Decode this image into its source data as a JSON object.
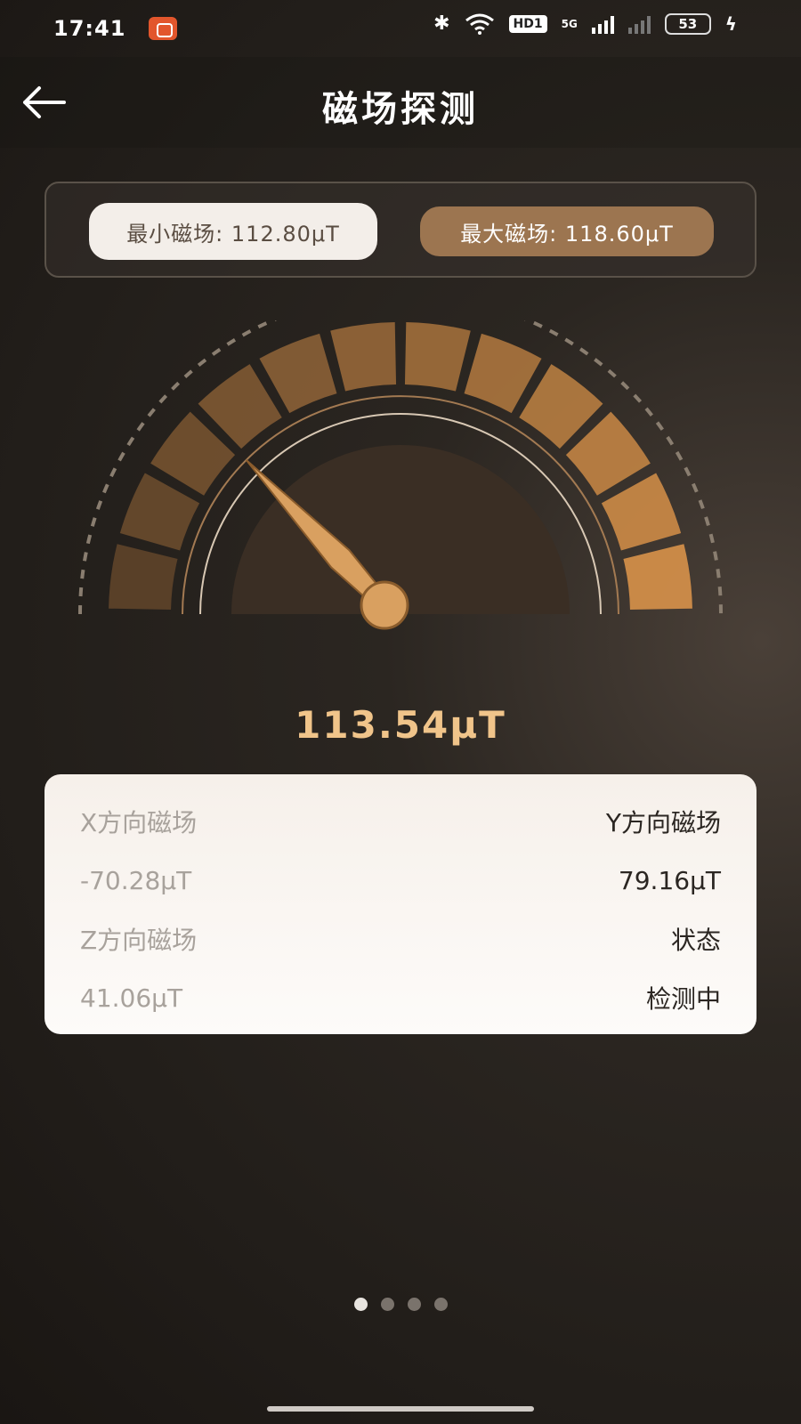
{
  "status_bar": {
    "time": "17:41",
    "hd_label": "HD1",
    "network": "5G",
    "battery": "53"
  },
  "header": {
    "title": "磁场探测",
    "back_icon": "arrow-left-icon"
  },
  "range": {
    "min_label": "最小磁场: 112.80μT",
    "max_label": "最大磁场: 118.60μT"
  },
  "gauge": {
    "value_text": "113.54μT",
    "needle_fraction": 0.18
  },
  "axes": {
    "rows": [
      {
        "left": "X方向磁场",
        "right": "Y方向磁场"
      },
      {
        "left": "-70.28μT",
        "right": "79.16μT"
      },
      {
        "left": "Z方向磁场",
        "right": "状态"
      },
      {
        "left": "41.06μT",
        "right": "检测中"
      }
    ]
  },
  "pager": {
    "count": 4,
    "active": 0
  },
  "colors": {
    "accent": "#f0c48a",
    "gauge_dark": "#6b4a2a",
    "gauge_light": "#d8924a",
    "pill_max": "#9c7550",
    "pill_min": "#f3eee9"
  }
}
